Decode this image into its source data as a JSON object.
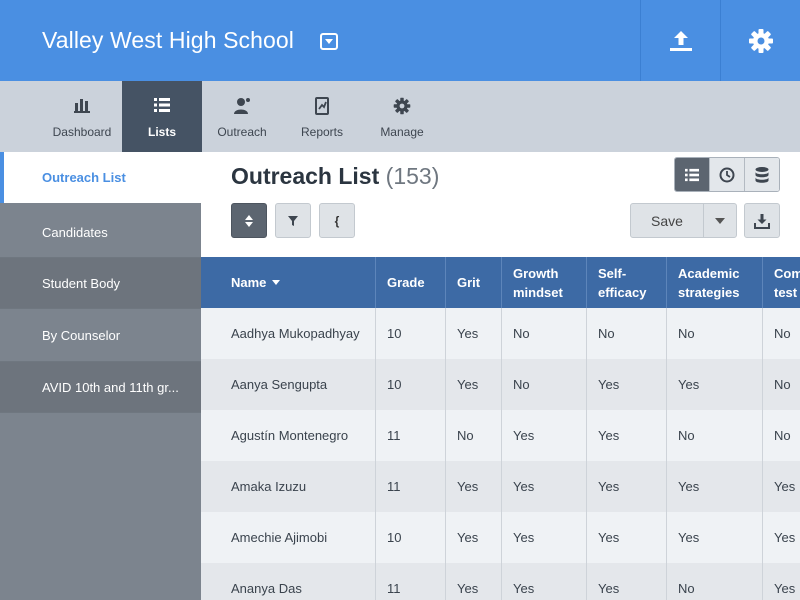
{
  "header": {
    "school_name": "Valley West High School",
    "icons": {
      "school_dropdown": "caret-down-box-icon",
      "upload": "upload-icon",
      "settings": "gear-icon"
    },
    "color": "#4a8fe2"
  },
  "nav": {
    "items": [
      {
        "label": "Dashboard",
        "icon": "bar-chart-icon",
        "active": false
      },
      {
        "label": "Lists",
        "icon": "list-icon",
        "active": true
      },
      {
        "label": "Outreach",
        "icon": "person-outreach-icon",
        "active": false
      },
      {
        "label": "Reports",
        "icon": "report-icon",
        "active": false
      },
      {
        "label": "Manage",
        "icon": "gear-icon",
        "active": false
      }
    ]
  },
  "sidebar": {
    "items": [
      {
        "label": "Outreach List",
        "active": true
      },
      {
        "label": "Candidates",
        "active": false
      },
      {
        "label": "Student Body",
        "active": false
      },
      {
        "label": "By Counselor",
        "active": false
      },
      {
        "label": "AVID 10th and 11th gr...",
        "active": false
      }
    ]
  },
  "main": {
    "title": "Outreach List",
    "count": "(153)",
    "view_toggle": [
      {
        "icon": "list-icon",
        "active": true
      },
      {
        "icon": "clock-icon",
        "active": false
      },
      {
        "icon": "database-icon",
        "active": false
      }
    ],
    "toolbar": {
      "sort_icon": "sort-icon",
      "filter_icon": "filter-icon",
      "brace_label": "{",
      "save_label": "Save",
      "save_dropdown_icon": "caret-down-icon",
      "export_icon": "download-icon"
    }
  },
  "table": {
    "columns": [
      {
        "label": "Name",
        "sorted": true
      },
      {
        "label": "Grade"
      },
      {
        "label": "Grit"
      },
      {
        "label": "Growth mindset"
      },
      {
        "label": "Self-efficacy"
      },
      {
        "label": "Academic strategies"
      },
      {
        "label": "Com test"
      }
    ],
    "rows": [
      [
        "Aadhya Mukopadhyay",
        "10",
        "Yes",
        "No",
        "No",
        "No",
        "No"
      ],
      [
        "Aanya Sengupta",
        "10",
        "Yes",
        "No",
        "Yes",
        "Yes",
        "No"
      ],
      [
        "Agustín Montenegro",
        "11",
        "No",
        "Yes",
        "Yes",
        "No",
        "No"
      ],
      [
        "Amaka Izuzu",
        "11",
        "Yes",
        "Yes",
        "Yes",
        "Yes",
        "Yes"
      ],
      [
        "Amechie Ajimobi",
        "10",
        "Yes",
        "Yes",
        "Yes",
        "Yes",
        "Yes"
      ],
      [
        "Ananya Das",
        "11",
        "Yes",
        "Yes",
        "Yes",
        "No",
        "Yes"
      ]
    ]
  }
}
